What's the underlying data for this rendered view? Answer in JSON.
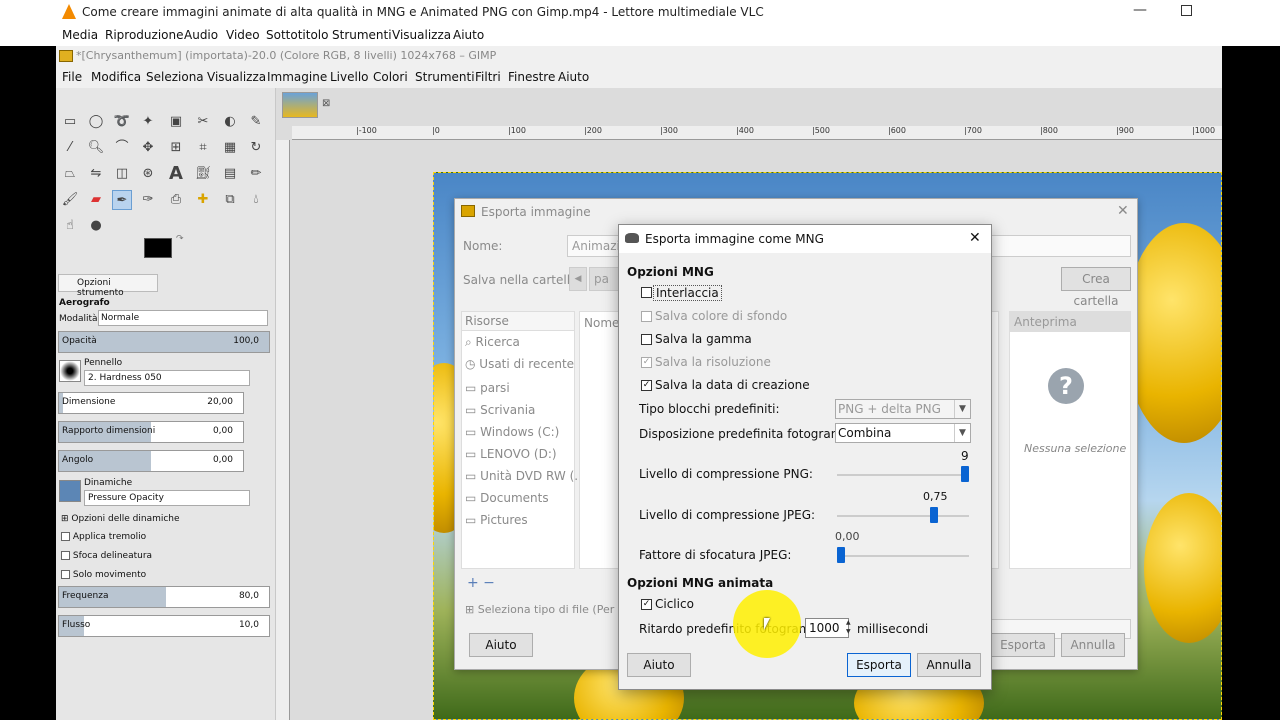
{
  "vlc": {
    "title": "Come creare immagini animate di alta qualità in MNG e Animated PNG con Gimp.mp4 - Lettore multimediale VLC",
    "menu": [
      "Media",
      "Riproduzione",
      "Audio",
      "Video",
      "Sottotitolo",
      "Strumenti",
      "Visualizza",
      "Aiuto"
    ]
  },
  "gimp": {
    "title": "*[Chrysanthemum] (importata)-20.0 (Colore RGB, 8 livelli) 1024x768 – GIMP",
    "menu": [
      "File",
      "Modifica",
      "Seleziona",
      "Visualizza",
      "Immagine",
      "Livello",
      "Colori",
      "Strumenti",
      "Filtri",
      "Finestre",
      "Aiuto"
    ],
    "ruler_labels": [
      "|-100",
      "|0",
      "|100",
      "|200",
      "|300",
      "|400",
      "|500",
      "|600",
      "|700",
      "|800",
      "|900",
      "|1000"
    ],
    "tool_options": {
      "tab": "Opzioni strumento",
      "tool": "Aerografo",
      "mode_label": "Modalità:",
      "mode_value": "Normale",
      "opacity_label": "Opacità",
      "opacity_value": "100,0",
      "brush_label": "Pennello",
      "brush_value": "2. Hardness 050",
      "size_label": "Dimensione",
      "size_value": "20,00",
      "ratio_label": "Rapporto dimensioni",
      "ratio_value": "0,00",
      "angle_label": "Angolo",
      "angle_value": "0,00",
      "dynamics_label": "Dinamiche",
      "dynamics_value": "Pressure Opacity",
      "dyn_options": "Opzioni delle dinamiche",
      "jitter": "Applica tremolio",
      "smooth": "Sfoca delineatura",
      "motion": "Solo movimento",
      "rate_label": "Frequenza",
      "rate_value": "80,0",
      "flow_label": "Flusso",
      "flow_value": "10,0"
    }
  },
  "export_dialog": {
    "title": "Esporta immagine",
    "name_label": "Nome:",
    "name_value": "Animazio",
    "folder_label": "Salva nella cartella:",
    "folder_value": "pa",
    "create_folder": "Crea cartella",
    "places_header": "Risorse",
    "places": [
      "Ricerca",
      "Usati di recente",
      "parsi",
      "Scrivania",
      "Windows (C:)",
      "LENOVO (D:)",
      "Unità DVD RW (...",
      "Documents",
      "Pictures"
    ],
    "name_col": "Nome",
    "preview": "Anteprima",
    "no_selection": "Nessuna selezione",
    "file_type": "Seleziona tipo di file (Per es",
    "help": "Aiuto",
    "export": "Esporta",
    "cancel": "Annulla"
  },
  "mng_dialog": {
    "title": "Esporta immagine come MNG",
    "section1": "Opzioni MNG",
    "interlace": "Interlaccia",
    "bg_color": "Salva colore di sfondo",
    "gamma": "Salva la gamma",
    "resolution": "Salva la risoluzione",
    "creation_date": "Salva la data di creazione",
    "chunk_label": "Tipo blocchi predefiniti:",
    "chunk_value": "PNG + delta PNG",
    "frame_disp_label": "Disposizione predefinita fotogrammi:",
    "frame_disp_value": "Combina",
    "png_comp_label": "Livello di compressione PNG:",
    "png_comp_value": "9",
    "jpeg_comp_label": "Livello di compressione JPEG:",
    "jpeg_comp_value": "0,75",
    "jpeg_smooth_label": "Fattore di sfocatura JPEG:",
    "jpeg_smooth_value": "0,00",
    "section2": "Opzioni MNG animata",
    "loop": "Ciclico",
    "delay_label": "Ritardo predefinito fotogrammi:",
    "delay_value": "1000",
    "delay_unit": "millisecondi",
    "help": "Aiuto",
    "export": "Esporta",
    "cancel": "Annulla",
    "png_comp_level": 1.0,
    "jpeg_comp_level": 0.75,
    "jpeg_smooth_level": 0.0
  },
  "colors": {
    "accent": "#0a64d2",
    "highlight": "#ffe600"
  }
}
